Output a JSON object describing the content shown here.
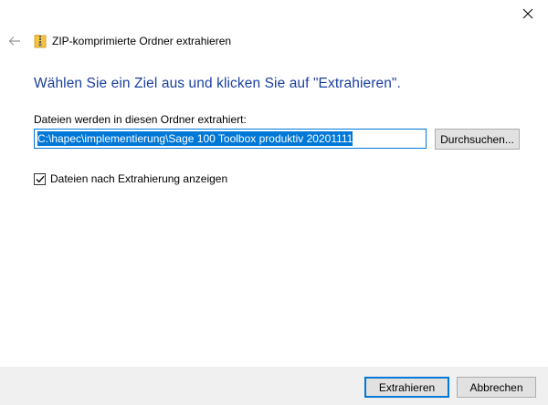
{
  "window": {
    "title": "ZIP-komprimierte Ordner extrahieren",
    "close_icon": "close-icon",
    "back_icon": "back-arrow-icon",
    "app_icon": "zip-folder-icon"
  },
  "main": {
    "heading": "Wählen Sie ein Ziel aus und klicken Sie auf \"Extrahieren\".",
    "path_label": "Dateien werden in diesen Ordner extrahiert:",
    "path_value": "C:\\hapec\\implementierung\\Sage 100 Toolbox produktiv 20201111",
    "browse_label": "Durchsuchen...",
    "show_files_label": "Dateien nach Extrahierung anzeigen",
    "show_files_checked": true
  },
  "footer": {
    "extract_label": "Extrahieren",
    "cancel_label": "Abbrechen"
  },
  "colors": {
    "heading": "#1a3f9f",
    "accent": "#0078d7",
    "footer_bg": "#f0f0f0"
  }
}
